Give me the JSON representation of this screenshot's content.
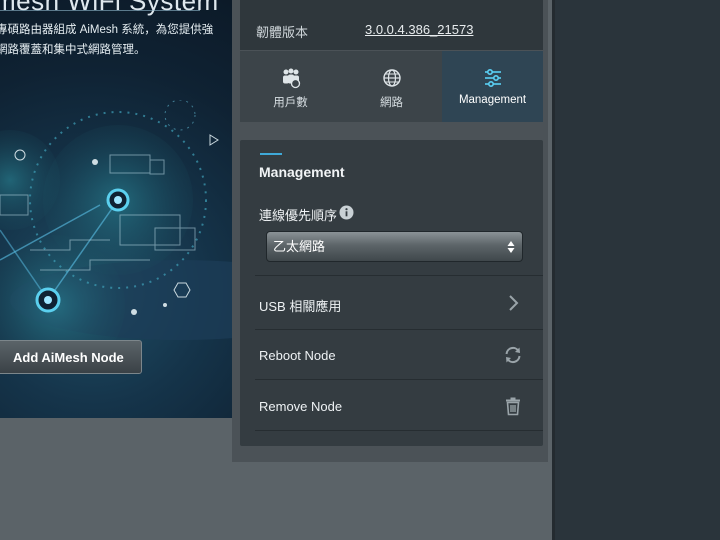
{
  "banner": {
    "title": "mesh WiFi System",
    "desc_line1": "專碩路由器組成 AiMesh 系統，為您提供強",
    "desc_line2": "網路覆蓋和集中式網路管理。",
    "add_button_label": "Add AiMesh Node"
  },
  "firmware": {
    "label": "韌體版本",
    "value": "3.0.0.4.386_21573"
  },
  "tabs": [
    {
      "label": "用戶數",
      "icon": "users-icon"
    },
    {
      "label": "網路",
      "icon": "globe-icon"
    },
    {
      "label": "Management",
      "icon": "sliders-icon",
      "active": true
    }
  ],
  "management": {
    "title": "Management",
    "priority_label": "連線優先順序",
    "priority_value": "乙太網路",
    "usb_label": "USB 相關應用",
    "reboot_label": "Reboot Node",
    "remove_label": "Remove Node"
  },
  "colors": {
    "accent": "#3fa9d8",
    "active_tab": "#2f4554",
    "card": "#343c41"
  }
}
